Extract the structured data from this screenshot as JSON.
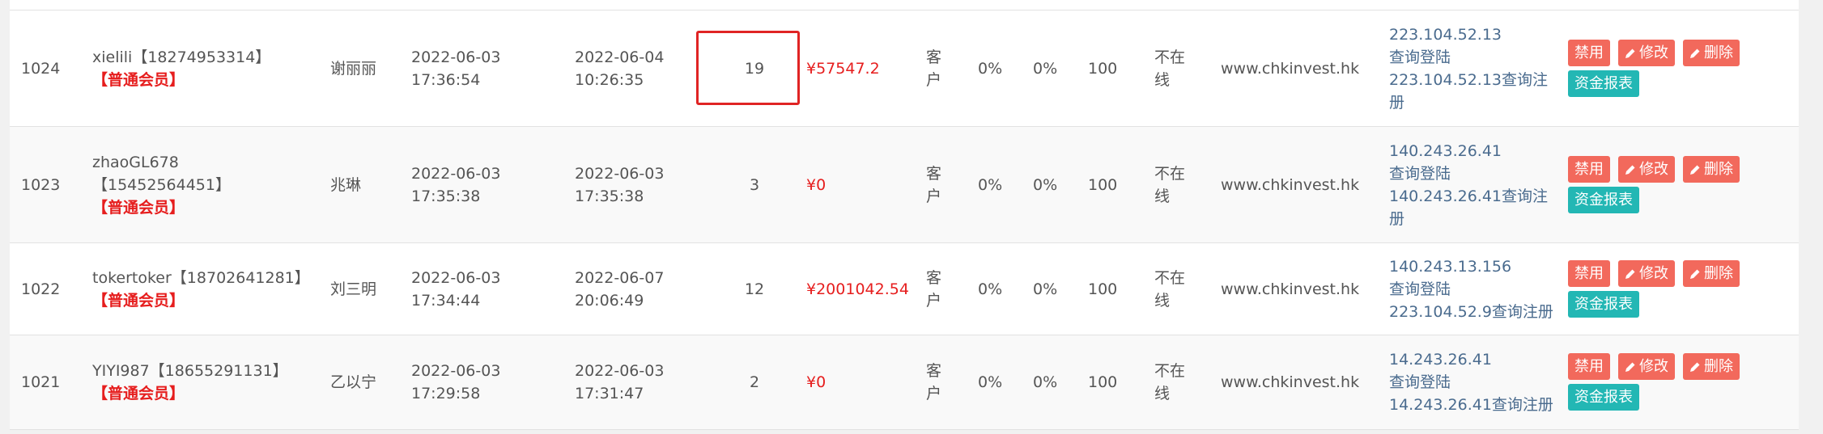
{
  "rows": [
    {
      "id": "1024",
      "user_line1": "xielili【18274953314】",
      "user_line2": "",
      "member": "【普通会员】",
      "name": "谢丽丽",
      "reg_date": "2022-06-03",
      "reg_time": "17:36:54",
      "login_date": "2022-06-04",
      "login_time": "10:26:35",
      "count": "19",
      "balance": "¥57547.2",
      "type_line1": "客",
      "type_line2": "户",
      "pct1": "0%",
      "pct2": "0%",
      "score": "100",
      "status_line1": "不在",
      "status_line2": "线",
      "domain": "www.chkinvest.hk",
      "ip_line1": "223.104.52.13",
      "ip_line2": "查询登陆",
      "ip_line3": "223.104.52.13查询注",
      "ip_line4": "册",
      "highlight": true
    },
    {
      "id": "1023",
      "user_line1": "zhaoGL678",
      "user_line2": "【15452564451】",
      "member": "【普通会员】",
      "name": "兆琳",
      "reg_date": "2022-06-03",
      "reg_time": "17:35:38",
      "login_date": "2022-06-03",
      "login_time": "17:35:38",
      "count": "3",
      "balance": "¥0",
      "type_line1": "客",
      "type_line2": "户",
      "pct1": "0%",
      "pct2": "0%",
      "score": "100",
      "status_line1": "不在",
      "status_line2": "线",
      "domain": "www.chkinvest.hk",
      "ip_line1": "140.243.26.41",
      "ip_line2": "查询登陆",
      "ip_line3": "140.243.26.41查询注",
      "ip_line4": "册",
      "highlight": false
    },
    {
      "id": "1022",
      "user_line1": "tokertoker【18702641281】",
      "user_line2": "",
      "member": "【普通会员】",
      "name": "刘三明",
      "reg_date": "2022-06-03",
      "reg_time": "17:34:44",
      "login_date": "2022-06-07",
      "login_time": "20:06:49",
      "count": "12",
      "balance": "¥2001042.54",
      "type_line1": "客",
      "type_line2": "户",
      "pct1": "0%",
      "pct2": "0%",
      "score": "100",
      "status_line1": "不在",
      "status_line2": "线",
      "domain": "www.chkinvest.hk",
      "ip_line1": "140.243.13.156",
      "ip_line2": "查询登陆",
      "ip_line3": "223.104.52.9查询注册",
      "ip_line4": "",
      "highlight": false
    },
    {
      "id": "1021",
      "user_line1": "YIYI987【18655291131】",
      "user_line2": "",
      "member": "【普通会员】",
      "name": "乙以宁",
      "reg_date": "2022-06-03",
      "reg_time": "17:29:58",
      "login_date": "2022-06-03",
      "login_time": "17:31:47",
      "count": "2",
      "balance": "¥0",
      "type_line1": "客",
      "type_line2": "户",
      "pct1": "0%",
      "pct2": "0%",
      "score": "100",
      "status_line1": "不在",
      "status_line2": "线",
      "domain": "www.chkinvest.hk",
      "ip_line1": "14.243.26.41",
      "ip_line2": "查询登陆",
      "ip_line3": "14.243.26.41查询注册",
      "ip_line4": "",
      "highlight": false
    }
  ],
  "actions": {
    "disable": "禁用",
    "edit": "修改",
    "delete": "删除",
    "funds_report": "资金报表"
  },
  "colors": {
    "red_button": "#f2695c",
    "teal_button": "#23b7b4",
    "member_red": "#e61e1e",
    "link_blue": "#4a6b8e",
    "highlight_border": "#e02424"
  },
  "icons": {
    "edit": "pencil-icon",
    "delete": "pencil-icon"
  }
}
